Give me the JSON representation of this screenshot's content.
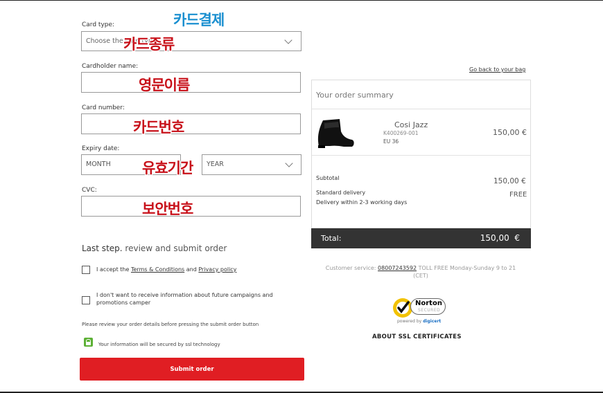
{
  "annotations": {
    "title": "카드결제",
    "card_type": "카드종류",
    "holder": "영문이름",
    "number": "카드번호",
    "expiry": "유효기간",
    "cvc": "보안번호"
  },
  "form": {
    "card_type_label": "Card type:",
    "card_type_placeholder": "Choose the card type",
    "holder_label": "Cardholder name:",
    "number_label": "Card number:",
    "expiry_label": "Expiry date:",
    "month_placeholder": "MONTH",
    "year_placeholder": "YEAR",
    "cvc_label": "CVC:"
  },
  "last_step": {
    "bold": "Last step.",
    "rest": "review and submit order",
    "accept_prefix": "I accept the",
    "terms_link": "Terms & Conditions",
    "and": "and",
    "privacy_link": "Privacy policy",
    "no_info": "I don't want to receive information about future campaigns and promotions camper",
    "review_note": "Please review your order details before pressing the submit order button",
    "ssl_note": "Your information will be secured by ssl technology",
    "submit_label": "Submit order"
  },
  "summary": {
    "back_link": "Go back to your bag",
    "title": "Your order summary",
    "product": {
      "name": "Cosi Jazz",
      "sku": "K400269-001",
      "size": "EU 36",
      "price": "150,00 €"
    },
    "subtotal_label": "Subtotal",
    "subtotal_value": "150,00 €",
    "delivery_label": "Standard delivery",
    "delivery_value": "FREE",
    "delivery_note": "Delivery  within 2-3 working days",
    "total_label": "Total:",
    "total_value": "150,00  €"
  },
  "service": {
    "prefix": "Customer service:",
    "phone": "08007243592",
    "rest": "TOLL FREE Monday-Sunday 9 to 21",
    "cet": "(CET)"
  },
  "norton": {
    "brand": "Norton",
    "secured": "SECURED",
    "powered": "powered by",
    "digicert": "digicert",
    "about": "ABOUT SSL CERTIFICATES"
  },
  "colors": {
    "submit": "#e01e23",
    "total_bar": "#333333",
    "annotation_red": "#c8111a",
    "annotation_blue": "#1a8fd0",
    "lock": "#5cb035",
    "norton_yellow": "#f2c200"
  }
}
